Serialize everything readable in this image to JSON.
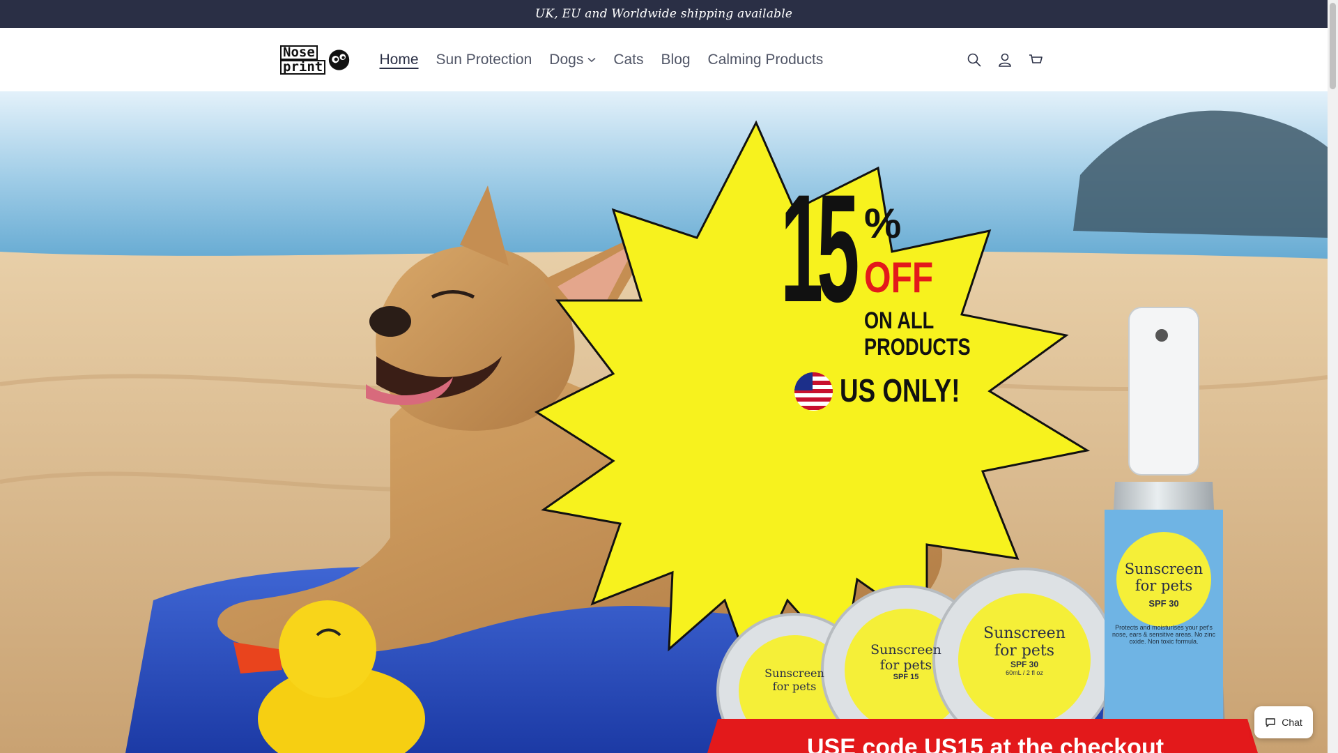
{
  "announcement": {
    "text": "UK, EU and Worldwide shipping available"
  },
  "brand": {
    "logo_line1": "Nose",
    "logo_line2": "print",
    "accent": "#2a2f45"
  },
  "nav": {
    "items": [
      {
        "label": "Home",
        "active": true
      },
      {
        "label": "Sun Protection"
      },
      {
        "label": "Dogs",
        "has_dropdown": true
      },
      {
        "label": "Cats"
      },
      {
        "label": "Blog"
      },
      {
        "label": "Calming Products"
      }
    ]
  },
  "header_icons": [
    "search-icon",
    "account-icon",
    "cart-icon"
  ],
  "hero": {
    "badge_number": "15",
    "badge_percent": "%",
    "badge_off": "OFF",
    "badge_line1": "ON ALL",
    "badge_line2": "PRODUCTS",
    "badge_country": "US ONLY!",
    "banner_text": "USE code US15 at the checkout",
    "badge_color": "#f7f21e",
    "off_color": "#e3191b",
    "banner_color": "#e3191b",
    "bottle_label1": "Sunscreen",
    "bottle_label2": "for pets",
    "bottle_spf": "SPF 30",
    "bottle_desc": "Protects and moisturises your pet's nose, ears & sensitive areas. No zinc oxide. Non toxic formula.",
    "tin_large_label1": "Sunscreen",
    "tin_large_label2": "for pets",
    "tin_large_spf": "SPF 30",
    "tin_large_size": "60mL / 2 fl oz",
    "tin_mid_label1": "Sunscreen",
    "tin_mid_label2": "for pets",
    "tin_mid_spf": "SPF 15",
    "tin_small_label1": "Sunscreen",
    "tin_small_label2": "for pets"
  },
  "chat": {
    "label": "Chat"
  }
}
